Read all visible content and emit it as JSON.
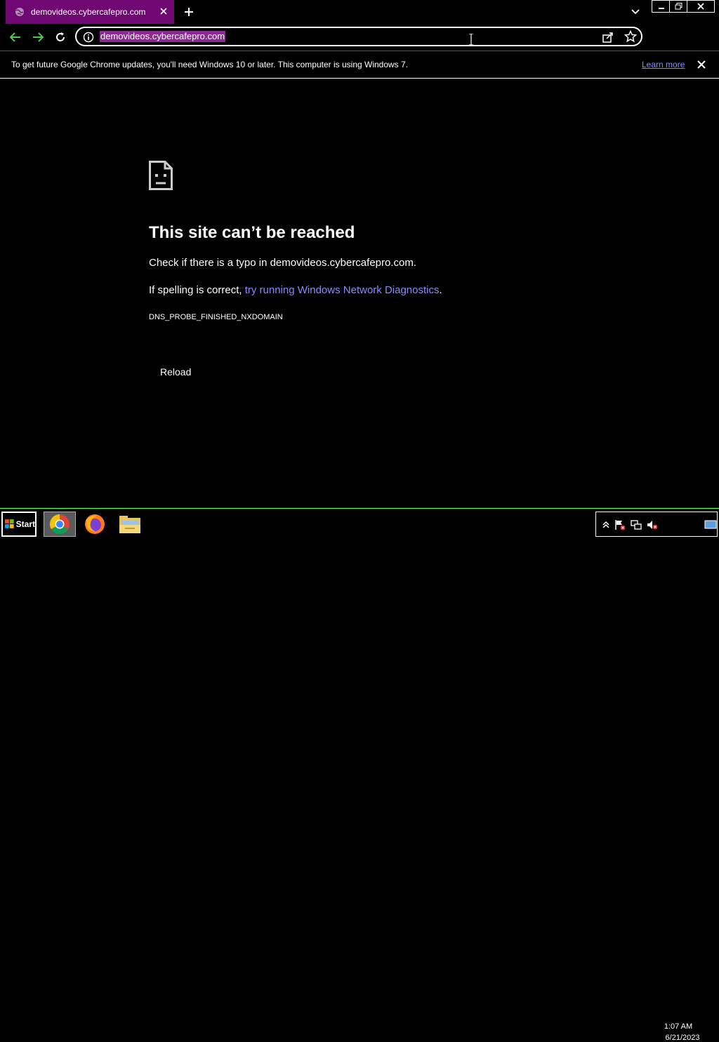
{
  "browser": {
    "tab_title": "demovideos.cybercafepro.com",
    "url": "demovideos.cybercafepro.com"
  },
  "infobar": {
    "message": "To get future Google Chrome updates, you'll need Windows 10 or later. This computer is using Windows 7.",
    "learn_more": "Learn more"
  },
  "error_page": {
    "heading": "This site can’t be reached",
    "line1": "Check if there is a typo in demovideos.cybercafepro.com.",
    "line2_prefix": "If spelling is correct, ",
    "line2_link": "try running Windows Network Diagnostics",
    "line2_suffix": ".",
    "error_code": "DNS_PROBE_FINISHED_NXDOMAIN",
    "reload_label": "Reload"
  },
  "taskbar": {
    "start_label": "Start",
    "apps": [
      "chrome-icon",
      "firefox-icon",
      "file-explorer-icon"
    ],
    "clock_time": "1:07 AM",
    "clock_date": "6/21/2023"
  },
  "colors": {
    "tab_active": "#6f0873",
    "url_selection": "#8a2b8f",
    "link": "#8a8aff",
    "nav_arrow": "#4cc94c",
    "taskbar_border": "#4cff4c"
  }
}
